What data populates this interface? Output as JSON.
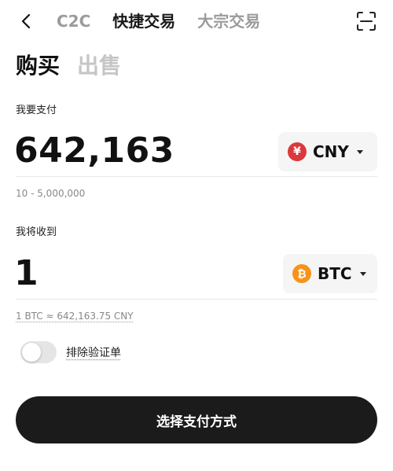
{
  "nav": {
    "tabs": [
      {
        "label": "C2C"
      },
      {
        "label": "快捷交易"
      },
      {
        "label": "大宗交易"
      }
    ],
    "icons": {
      "back": "chevron-left-icon",
      "scan": "scan-icon"
    }
  },
  "trade": {
    "tabs": [
      {
        "label": "购买"
      },
      {
        "label": "出售"
      }
    ]
  },
  "pay": {
    "label": "我要支付",
    "amount": "642,163",
    "currency": "CNY",
    "currency_symbol": "¥",
    "range": "10 - 5,000,000"
  },
  "receive": {
    "label": "我将收到",
    "amount": "1",
    "currency": "BTC",
    "currency_symbol": "₿",
    "rate": "1 BTC ≈ 642,163.75 CNY"
  },
  "filter": {
    "label": "排除验证单",
    "enabled": false
  },
  "action": {
    "label": "选择支付方式"
  },
  "colors": {
    "cny_coin": "#d9393d",
    "btc_coin": "#f7931a",
    "primary_button": "#1b1b1b"
  }
}
